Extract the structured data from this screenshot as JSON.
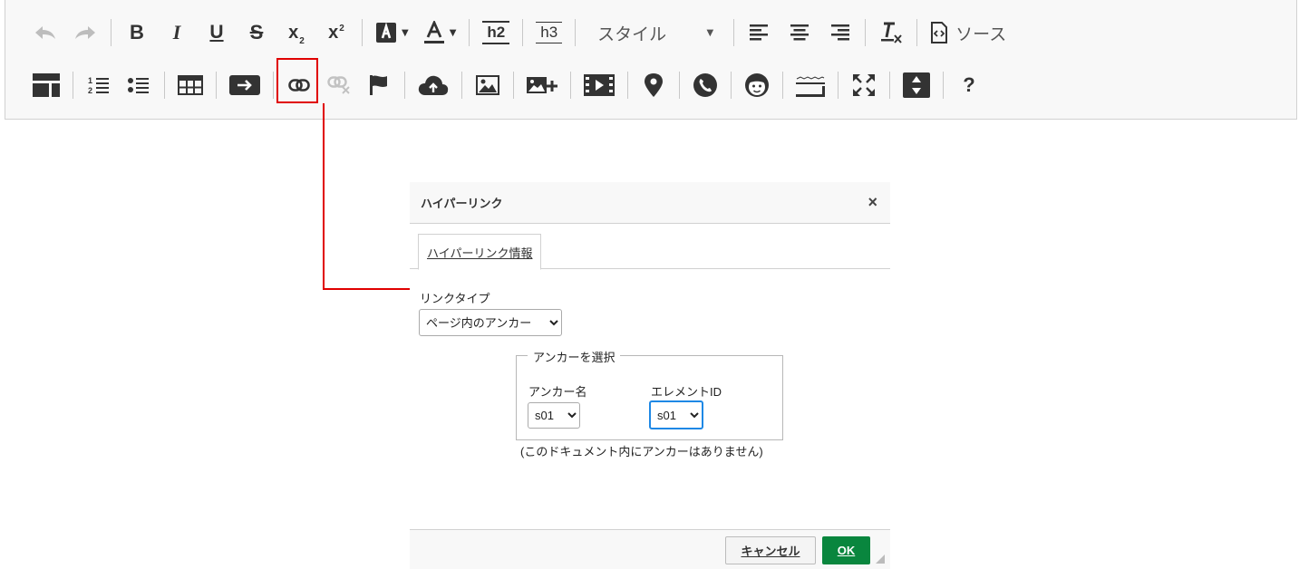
{
  "toolbar": {
    "heading2_label": "h2",
    "heading3_label": "h3",
    "style_combo": {
      "label": "スタイル"
    },
    "source_label": "ソース",
    "help_label": "?",
    "highlighted_button": "link-icon",
    "colors": {
      "highlight": "#e00000"
    }
  },
  "dialog": {
    "title": "ハイパーリンク",
    "close_label": "×",
    "tab_label": "ハイパーリンク情報",
    "link_type_label": "リンクタイプ",
    "link_type_value": "ページ内のアンカー",
    "anchor_group_label": "アンカーを選択",
    "anchor_name_label": "アンカー名",
    "anchor_name_value": "s01",
    "element_id_label": "エレメントID",
    "element_id_value": "s01",
    "no_anchor_note": "(このドキュメント内にアンカーはありません)",
    "cancel_label": "キャンセル",
    "ok_label": "OK",
    "colors": {
      "ok_button": "#09863e"
    }
  }
}
